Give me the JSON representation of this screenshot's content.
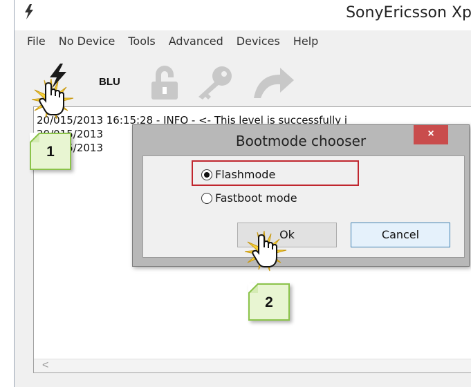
{
  "window": {
    "title": "SonyEricsson Xp"
  },
  "menu": [
    "File",
    "No Device",
    "Tools",
    "Advanced",
    "Devices",
    "Help"
  ],
  "toolbar": {
    "blu_label": "BLU",
    "icons": [
      "flash-icon",
      "lock-icon",
      "key-icon",
      "redo-arrow-icon"
    ]
  },
  "log": {
    "lines": [
      "20/015/2013 16:15:28 - INFO  - <- This level is successfully i",
      "20/015/2013",
      "20/015/2013"
    ],
    "scroll_left": "<"
  },
  "dialog": {
    "title": "Bootmode chooser",
    "close_label": "×",
    "options": [
      {
        "label": "Flashmode",
        "checked": true
      },
      {
        "label": "Fastboot mode",
        "checked": false
      }
    ],
    "ok_label": "Ok",
    "cancel_label": "Cancel"
  },
  "callouts": {
    "step1": "1",
    "step2": "2"
  },
  "colors": {
    "highlight": "#c0262e",
    "callout_border": "#8bc34a",
    "callout_fill": "#e8f5d2",
    "close_button": "#c94c4c",
    "cancel_border": "#3c7fb1"
  }
}
